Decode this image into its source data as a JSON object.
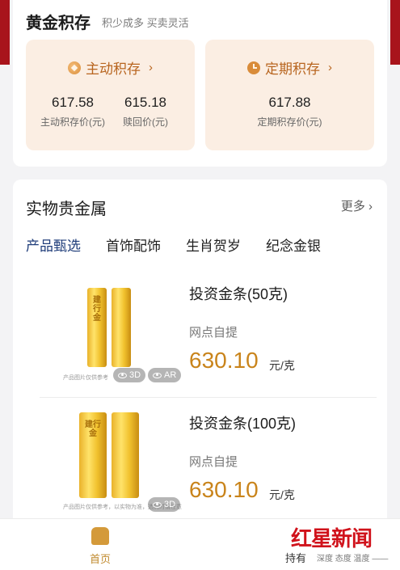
{
  "gold_savings": {
    "title": "黄金积存",
    "subtitle": "积少成多 买卖灵活",
    "active": {
      "label": "主动积存",
      "chevron": "›",
      "price1": "617.58",
      "price1_label": "主动积存价(元)",
      "price2": "615.18",
      "price2_label": "赎回价(元)"
    },
    "fixed": {
      "label": "定期积存",
      "chevron": "›",
      "price": "617.88",
      "price_label": "定期积存价(元)"
    }
  },
  "precious_metals": {
    "title": "实物贵金属",
    "more": "更多 ›",
    "tabs": [
      "产品甄选",
      "首饰配饰",
      "生肖贺岁",
      "纪念金银"
    ],
    "products": [
      {
        "name": "投资金条(50克)",
        "tag": "网点自提",
        "price": "630.10",
        "unit": "元/克",
        "bar_text": "建行金",
        "badge_3d": "3D",
        "badge_ar": "AR",
        "note": "产品图片仅供参考"
      },
      {
        "name": "投资金条(100克)",
        "tag": "网点自提",
        "price": "630.10",
        "unit": "元/克",
        "bar_text": "建行金",
        "badge_3d": "3D",
        "note": "产品图片仅供参考，以实物为准，选购时请注意"
      }
    ]
  },
  "bottom_nav": {
    "home": "首页",
    "holdings": "持有"
  },
  "watermark": {
    "brand": "红星新闻",
    "tagline": "深度 态度 温度 ——"
  },
  "colors": {
    "accent_gold": "#c9841b",
    "panel_bg": "#fbeee3",
    "tab_active": "#1f3d7a",
    "brand_red": "#d0121b"
  }
}
